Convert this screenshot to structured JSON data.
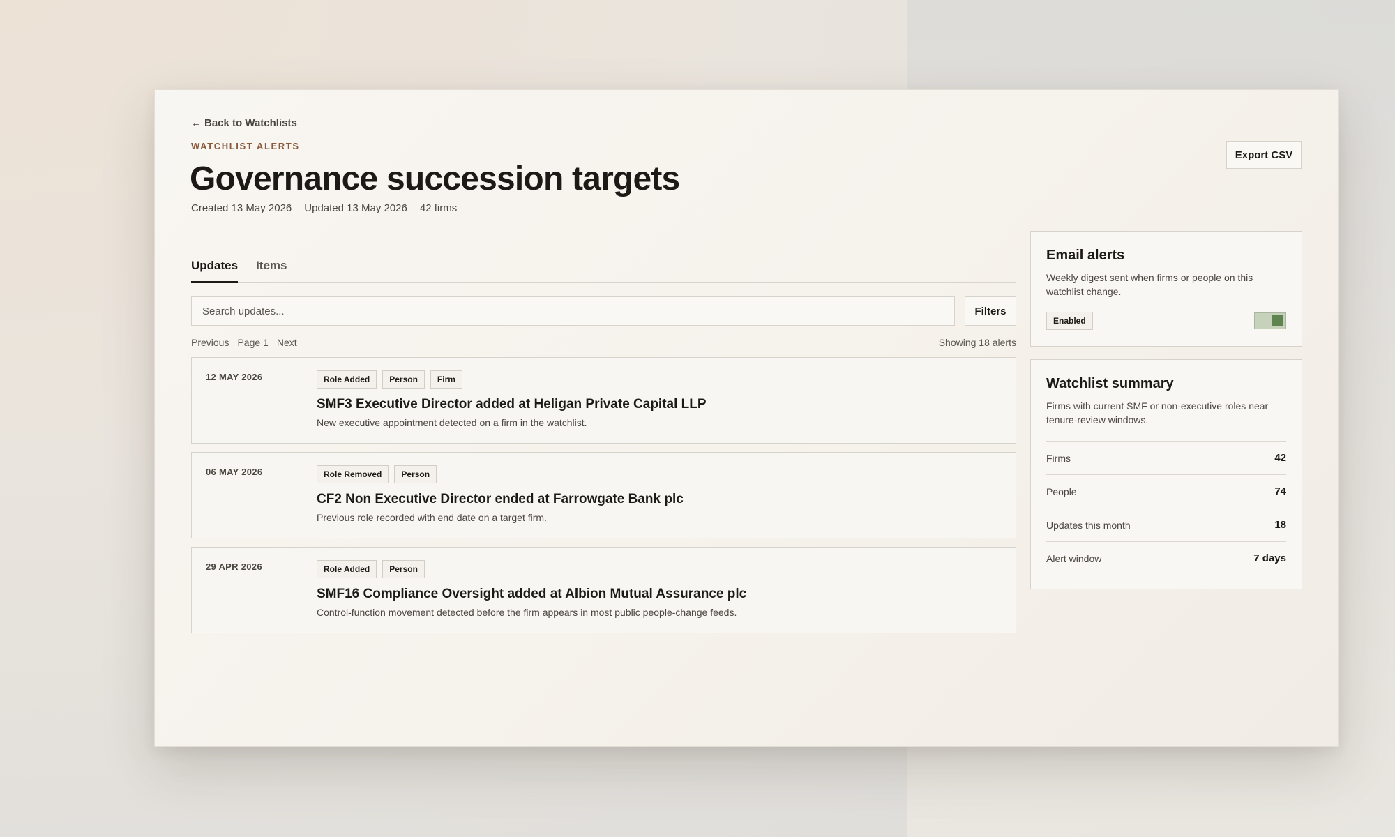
{
  "header": {
    "back_link": "Back to Watchlists",
    "eyebrow": "WATCHLIST ALERTS",
    "title": "Governance succession targets",
    "meta": {
      "created": "Created 13 May 2026",
      "updated": "Updated 13 May 2026",
      "firms": "42 firms"
    },
    "export_label": "Export CSV"
  },
  "tabs": [
    {
      "label": "Updates",
      "active": true
    },
    {
      "label": "Items",
      "active": false
    }
  ],
  "search": {
    "placeholder": "Search updates...",
    "value": "",
    "filters_label": "Filters"
  },
  "pager": {
    "previous": "Previous",
    "page": "Page 1",
    "next": "Next",
    "showing": "Showing 18 alerts"
  },
  "updates": [
    {
      "date": "12 MAY 2026",
      "tags": [
        "Role Added",
        "Person",
        "Firm"
      ],
      "title": "SMF3 Executive Director added at Heligan Private Capital LLP",
      "description": "New executive appointment detected on a firm in the watchlist."
    },
    {
      "date": "06 MAY 2026",
      "tags": [
        "Role Removed",
        "Person"
      ],
      "title": "CF2 Non Executive Director ended at Farrowgate Bank plc",
      "description": "Previous role recorded with end date on a target firm."
    },
    {
      "date": "29 APR 2026",
      "tags": [
        "Role Added",
        "Person"
      ],
      "title": "SMF16 Compliance Oversight added at Albion Mutual Assurance plc",
      "description": "Control-function movement detected before the firm appears in most public people-change feeds."
    }
  ],
  "email_alerts": {
    "title": "Email alerts",
    "description": "Weekly digest sent when firms or people on this watchlist change.",
    "status": "Enabled",
    "enabled": true
  },
  "summary": {
    "title": "Watchlist summary",
    "description": "Firms with current SMF or non-executive roles near tenure-review windows.",
    "stats": [
      {
        "label": "Firms",
        "value": "42"
      },
      {
        "label": "People",
        "value": "74"
      },
      {
        "label": "Updates this month",
        "value": "18"
      },
      {
        "label": "Alert window",
        "value": "7 days"
      }
    ]
  },
  "colors": {
    "accent": "#8a5a3c",
    "toggle_on": "#5f8450",
    "text": "#1c1a17"
  }
}
